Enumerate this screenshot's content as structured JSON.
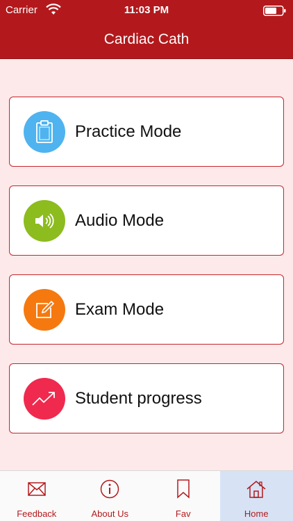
{
  "status_bar": {
    "carrier": "Carrier",
    "time": "11:03 PM",
    "icons": [
      "wifi-icon",
      "battery-icon"
    ]
  },
  "header": {
    "title": "Cardiac Cath"
  },
  "modes": [
    {
      "label": "Practice Mode",
      "icon": "clipboard-icon",
      "color": "#4fb3ef"
    },
    {
      "label": "Audio Mode",
      "icon": "speaker-icon",
      "color": "#8cbc1e"
    },
    {
      "label": "Exam Mode",
      "icon": "edit-icon",
      "color": "#f5790f"
    },
    {
      "label": "Student progress",
      "icon": "trending-up-icon",
      "color": "#f0294e"
    }
  ],
  "tab_bar": {
    "tabs": [
      {
        "label": "Feedback",
        "icon": "envelope-icon"
      },
      {
        "label": "About Us",
        "icon": "info-icon"
      },
      {
        "label": "Fav",
        "icon": "bookmark-icon"
      },
      {
        "label": "Home",
        "icon": "home-icon"
      }
    ],
    "active": "Home"
  },
  "colors": {
    "brand": "#b3191c",
    "background": "#fde9ea",
    "active_tab": "#d7e3f5"
  }
}
